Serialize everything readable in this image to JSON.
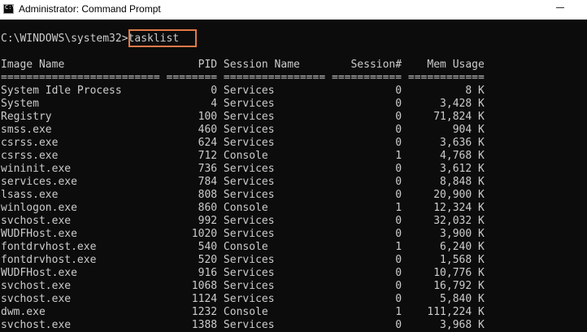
{
  "window": {
    "title": "Administrator: Command Prompt",
    "icon": "command-prompt-icon",
    "icon_glyph": "C:\\"
  },
  "terminal": {
    "prompt": "C:\\WINDOWS\\system32>",
    "command": "tasklist",
    "header": "Image Name                     PID Session Name        Session#    Mem Usage",
    "separator": "========================= ======== ================ =========== ============",
    "rows": [
      "System Idle Process              0 Services                   0          8 K",
      "System                           4 Services                   0      3,428 K",
      "Registry                       100 Services                   0     71,824 K",
      "smss.exe                       460 Services                   0        904 K",
      "csrss.exe                      624 Services                   0      3,636 K",
      "csrss.exe                      712 Console                    1      4,768 K",
      "wininit.exe                    736 Services                   0      3,612 K",
      "services.exe                   784 Services                   0      8,848 K",
      "lsass.exe                      808 Services                   0     20,900 K",
      "winlogon.exe                   860 Console                    1     12,324 K",
      "svchost.exe                    992 Services                   0     32,032 K",
      "WUDFHost.exe                  1020 Services                   0      3,900 K",
      "fontdrvhost.exe                540 Console                    1      6,240 K",
      "fontdrvhost.exe                520 Services                   0      1,568 K",
      "WUDFHost.exe                   916 Services                   0     10,776 K",
      "svchost.exe                   1068 Services                   0     16,792 K",
      "svchost.exe                   1124 Services                   0      5,840 K",
      "dwm.exe                       1232 Console                    1    111,224 K",
      "svchost.exe                   1388 Services                   0      3,968 K"
    ]
  },
  "colors": {
    "terminal_bg": "#0c0c0c",
    "terminal_fg": "#cccccc",
    "highlight": "#e07a47"
  }
}
